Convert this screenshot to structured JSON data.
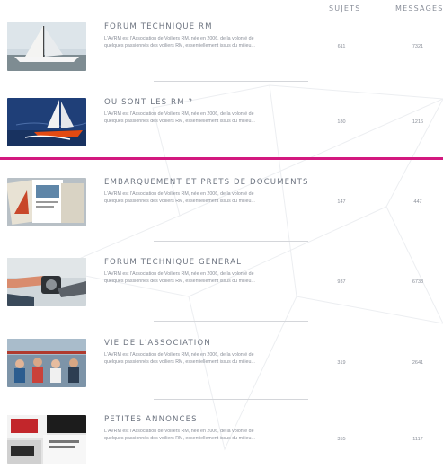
{
  "columns": {
    "sujets": "SUJETS",
    "messages": "MESSAGES"
  },
  "colors": {
    "accent": "#d3187f",
    "title": "#6d7480",
    "text": "#8a8f99"
  },
  "forums": [
    {
      "title": "FORUM TECHNIQUE RM",
      "description": "L'AVRM est l'Association de Voiliers RM, née en 2006, de la volonté de quelques passionnés des voiliers RM, essentiellement issus du milieu...",
      "sujets": "611",
      "messages": "7321",
      "image_icon": "sailboat-photo-icon"
    },
    {
      "title": "OU SONT LES RM ?",
      "description": "L'AVRM est l'Association de Voiliers RM, née en 2006, de la volonté de quelques passionnés des voiliers RM, essentiellement issus du milieu...",
      "sujets": "180",
      "messages": "1216",
      "image_icon": "sailing-sea-photo-icon"
    },
    {
      "title": "EMBARQUEMENT ET PRETS DE DOCUMENTS",
      "description": "L'AVRM est l'Association de Voiliers RM, née en 2006, de la volonté de quelques passionnés des voiliers RM, essentiellement issus du milieu...",
      "sujets": "147",
      "messages": "447",
      "image_icon": "documents-photo-icon"
    },
    {
      "title": "FORUM TECHNIQUE GENERAL",
      "description": "L'AVRM est l'Association de Voiliers RM, née en 2006, de la volonté de quelques passionnés des voiliers RM, essentiellement issus du milieu...",
      "sujets": "937",
      "messages": "6738",
      "image_icon": "winch-photo-icon"
    },
    {
      "title": "VIE DE L'ASSOCIATION",
      "description": "L'AVRM est l'Association de Voiliers RM, née en 2006, de la volonté de quelques passionnés des voiliers RM, essentiellement issus du milieu...",
      "sujets": "319",
      "messages": "2641",
      "image_icon": "group-photo-icon"
    },
    {
      "title": "PETITES ANNONCES",
      "description": "L'AVRM est l'Association de Voiliers RM, née en 2006, de la volonté de quelques passionnés des voiliers RM, essentiellement issus du milieu...",
      "sujets": "355",
      "messages": "1117",
      "image_icon": "newspaper-photo-icon"
    }
  ]
}
